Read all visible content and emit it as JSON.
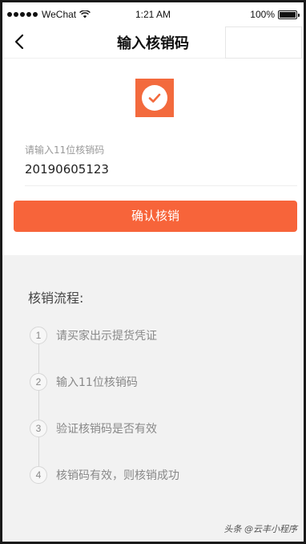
{
  "status_bar": {
    "carrier": "WeChat",
    "time": "1:21 AM",
    "battery_text": "100%",
    "battery_level": 1.0
  },
  "nav": {
    "title": "输入核销码",
    "back_icon": "chevron-left-icon"
  },
  "logo": {
    "icon": "check-circle-icon",
    "color": "#f36a3d"
  },
  "form": {
    "label": "请输入11位核销码",
    "value": "20190605123"
  },
  "confirm_button": {
    "label": "确认核销",
    "color": "#f7643a"
  },
  "steps": {
    "title": "核销流程:",
    "items": [
      {
        "num": "1",
        "text": "请买家出示提货凭证"
      },
      {
        "num": "2",
        "text": "输入11位核销码"
      },
      {
        "num": "3",
        "text": "验证核销码是否有效"
      },
      {
        "num": "4",
        "text": "核销码有效，则核销成功"
      }
    ]
  },
  "watermark": "头条 @云丰小程序"
}
